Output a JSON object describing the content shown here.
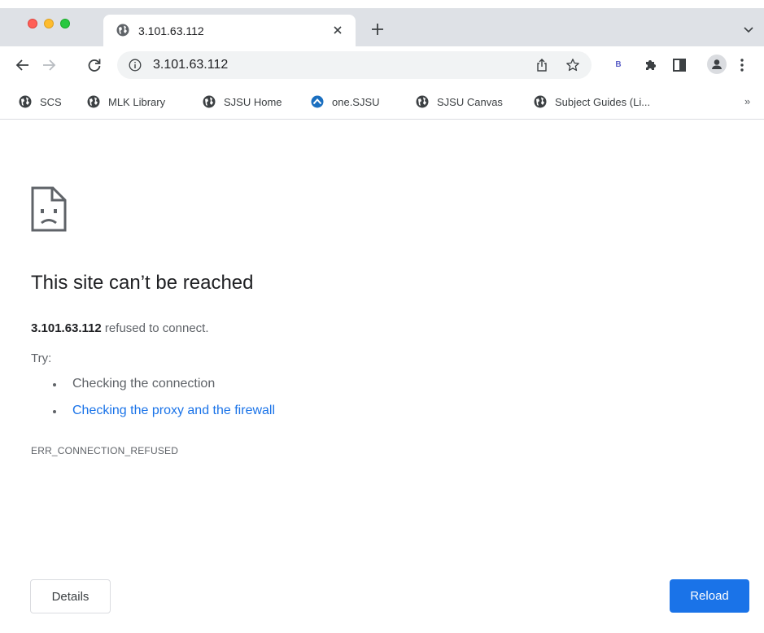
{
  "window": {
    "tab": {
      "title": "3.101.63.112",
      "favicon": "globe-icon"
    }
  },
  "toolbar": {
    "url": "3.101.63.112",
    "extension_label": "B"
  },
  "bookmarks": [
    {
      "label": "SCS",
      "icon": "globe-icon"
    },
    {
      "label": "MLK Library",
      "icon": "globe-icon"
    },
    {
      "label": "SJSU Home",
      "icon": "globe-icon"
    },
    {
      "label": "one.SJSU",
      "icon": "onesjsu-logo-icon"
    },
    {
      "label": "SJSU Canvas",
      "icon": "globe-icon"
    },
    {
      "label": "Subject Guides (Li...",
      "icon": "globe-icon"
    }
  ],
  "bookmarks_overflow": "»",
  "error": {
    "heading": "This site can’t be reached",
    "host": "3.101.63.112",
    "summary_rest": " refused to connect.",
    "try_label": "Try:",
    "suggestions": [
      "Checking the connection",
      "Checking the proxy and the firewall"
    ],
    "code": "ERR_CONNECTION_REFUSED"
  },
  "buttons": {
    "details": "Details",
    "reload": "Reload"
  },
  "colors": {
    "accent": "#1a73e8",
    "tabstrip": "#dee1e6",
    "omnibox": "#f1f3f4"
  }
}
